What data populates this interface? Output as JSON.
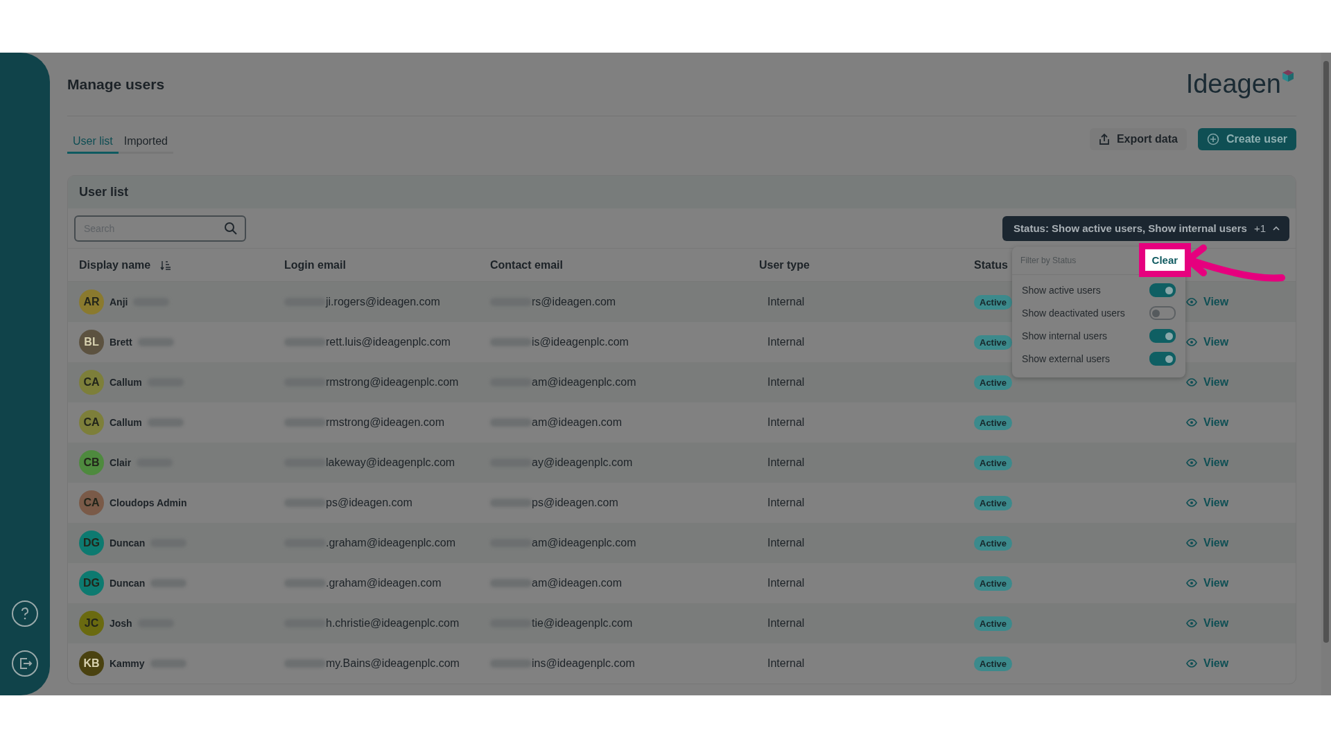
{
  "header": {
    "title": "Manage users",
    "logo": "Ideagen"
  },
  "tabs": [
    {
      "label": "User list",
      "selected": true
    },
    {
      "label": "Imported",
      "selected": false
    }
  ],
  "actions": [
    {
      "label": "Export data",
      "kind": "export"
    },
    {
      "label": "Create user",
      "kind": "create"
    }
  ],
  "panel": {
    "title": "User list",
    "search": {
      "placeholder": "Search"
    }
  },
  "filter": {
    "summary": "Status: Show active users, Show internal users",
    "extra": "+1",
    "expanded": true,
    "heading": "Filter by Status",
    "clear": "Clear",
    "options": [
      {
        "label": "Show active users",
        "on": true
      },
      {
        "label": "Show deactivated users",
        "on": false
      },
      {
        "label": "Show internal users",
        "on": true
      },
      {
        "label": "Show external users",
        "on": true
      }
    ]
  },
  "table": {
    "columns": [
      "Display name",
      "Login email",
      "Contact email",
      "User type",
      "Status"
    ],
    "rows": [
      {
        "initials": "AR",
        "color": "#8a7a2e",
        "name": "Anji",
        "surname_blurred": true,
        "login": "ji.rogers@ideagen.com",
        "contact": "rs@ideagen.com",
        "type": "Internal",
        "status": "Active",
        "action": "View"
      },
      {
        "initials": "BL",
        "color": "#5c5240",
        "name": "Brett",
        "surname_blurred": true,
        "login": "rett.luis@ideagenplc.com",
        "contact": "is@ideagenplc.com",
        "type": "Internal",
        "status": "Active",
        "action": "View"
      },
      {
        "initials": "CA",
        "color": "#7d7f3a",
        "name": "Callum",
        "surname_blurred": true,
        "login": "rmstrong@ideagenplc.com",
        "contact": "am@ideagenplc.com",
        "type": "Internal",
        "status": "Active",
        "action": "View"
      },
      {
        "initials": "CA",
        "color": "#7d7f3a",
        "name": "Callum",
        "surname_blurred": true,
        "login": "rmstrong@ideagen.com",
        "contact": "am@ideagen.com",
        "type": "Internal",
        "status": "Active",
        "action": "View"
      },
      {
        "initials": "CB",
        "color": "#4e8a3e",
        "name": "Clair",
        "surname_blurred": true,
        "login": "lakeway@ideagenplc.com",
        "contact": "ay@ideagenplc.com",
        "type": "Internal",
        "status": "Active",
        "action": "View"
      },
      {
        "initials": "CA",
        "color": "#7a5a48",
        "name": "Cloudops Admin",
        "surname_blurred": false,
        "login": "ps@ideagen.com",
        "contact": "ps@ideagen.com",
        "type": "Internal",
        "status": "Active",
        "action": "View"
      },
      {
        "initials": "DG",
        "color": "#0d7a70",
        "name": "Duncan",
        "surname_blurred": true,
        "login": ".graham@ideagenplc.com",
        "contact": "am@ideagenplc.com",
        "type": "Internal",
        "status": "Active",
        "action": "View"
      },
      {
        "initials": "DG",
        "color": "#0d7a70",
        "name": "Duncan",
        "surname_blurred": true,
        "login": ".graham@ideagen.com",
        "contact": "am@ideagen.com",
        "type": "Internal",
        "status": "Active",
        "action": "View"
      },
      {
        "initials": "JC",
        "color": "#6a6a10",
        "name": "Josh",
        "surname_blurred": true,
        "login": "h.christie@ideagenplc.com",
        "contact": "tie@ideagenplc.com",
        "type": "Internal",
        "status": "Active",
        "action": "View"
      },
      {
        "initials": "KB",
        "color": "#4a4210",
        "name": "Kammy",
        "surname_blurred": true,
        "login": "my.Bains@ideagenplc.com",
        "contact": "ins@ideagenplc.com",
        "type": "Internal",
        "status": "Active",
        "action": "View"
      }
    ]
  }
}
